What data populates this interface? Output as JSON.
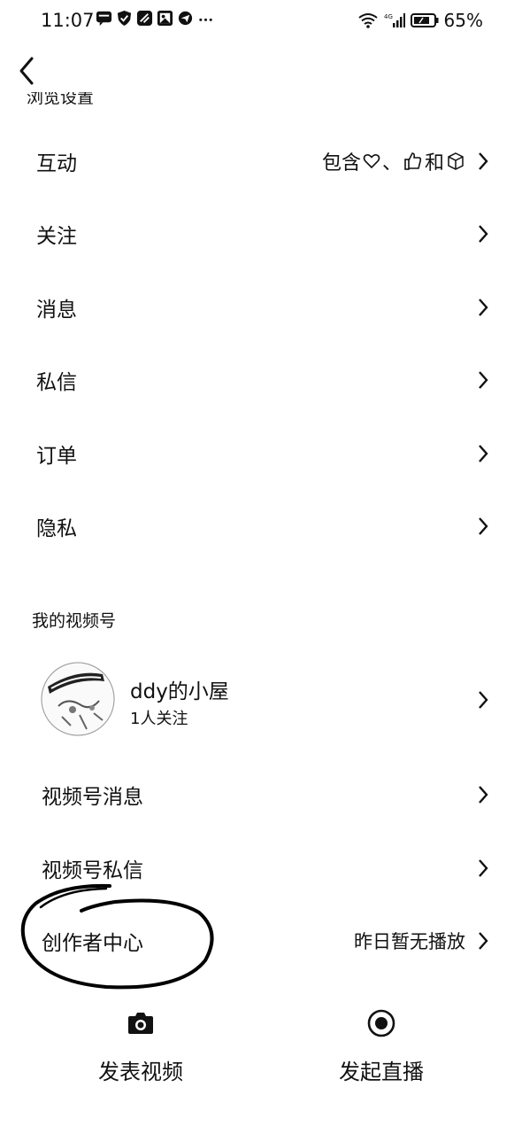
{
  "status_bar": {
    "time": "11:07",
    "battery": "65%",
    "icons": [
      "chat-notification-icon",
      "shield-icon",
      "app-icon",
      "gallery-icon",
      "telegram-icon",
      "more-dots-icon"
    ],
    "right_icons": [
      "wifi-icon",
      "signal-4g-icon",
      "battery-icon"
    ]
  },
  "nav": {
    "back_icon": "back-arrow-icon",
    "cut_heading": "浏览设置"
  },
  "settings": {
    "rows": [
      {
        "label": "互动",
        "value_prefix": "包含",
        "value_sep": "、",
        "value_and": "和"
      },
      {
        "label": "关注"
      },
      {
        "label": "消息"
      },
      {
        "label": "私信"
      },
      {
        "label": "订单"
      },
      {
        "label": "隐私"
      }
    ]
  },
  "channels": {
    "section_title": "我的视频号",
    "profile": {
      "name": "ddy的小屋",
      "followers": "1人关注"
    },
    "rows": [
      {
        "label": "视频号消息"
      },
      {
        "label": "视频号私信"
      },
      {
        "label": "创作者中心",
        "value": "昨日暂无播放"
      }
    ]
  },
  "bottom": {
    "publish_label": "发表视频",
    "publish_icon": "camera-icon",
    "live_label": "发起直播",
    "live_icon": "live-record-icon"
  },
  "annotation": {
    "type": "hand-drawn-circle",
    "target": "创作者中心",
    "color": "#000000"
  }
}
